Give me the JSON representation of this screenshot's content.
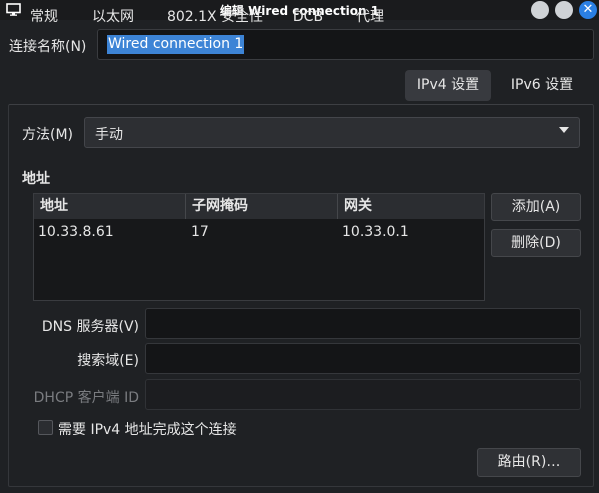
{
  "window": {
    "title": "编辑 Wired connection 1",
    "close_glyph": "✕"
  },
  "connection": {
    "name_label": "连接名称(N)",
    "name_value": "Wired connection 1"
  },
  "tabs": [
    {
      "label": "常规",
      "active": false
    },
    {
      "label": "以太网",
      "active": false
    },
    {
      "label": "802.1X 安全性",
      "active": false
    },
    {
      "label": "DCB",
      "active": false
    },
    {
      "label": "代理",
      "active": false
    },
    {
      "label": "IPv4 设置",
      "active": true
    },
    {
      "label": "IPv6 设置",
      "active": false
    }
  ],
  "ipv4": {
    "method_label": "方法(M)",
    "method_value": "手动",
    "address_heading": "地址",
    "columns": [
      "地址",
      "子网掩码",
      "网关"
    ],
    "rows": [
      [
        "10.33.8.61",
        "17",
        "10.33.0.1"
      ]
    ],
    "add_button": "添加(A)",
    "delete_button": "删除(D)",
    "dns_label": "DNS 服务器(V)",
    "dns_value": "",
    "search_label": "搜索域(E)",
    "search_value": "",
    "dhcp_label": "DHCP 客户端 ID",
    "dhcp_value": "",
    "require_label": "需要 IPv4 地址完成这个连接",
    "require_checked": false,
    "routes_button": "路由(R)…"
  },
  "colors": {
    "accent": "#3d84d6",
    "background": "#1f2124",
    "close_button": "#2b7fe3"
  }
}
